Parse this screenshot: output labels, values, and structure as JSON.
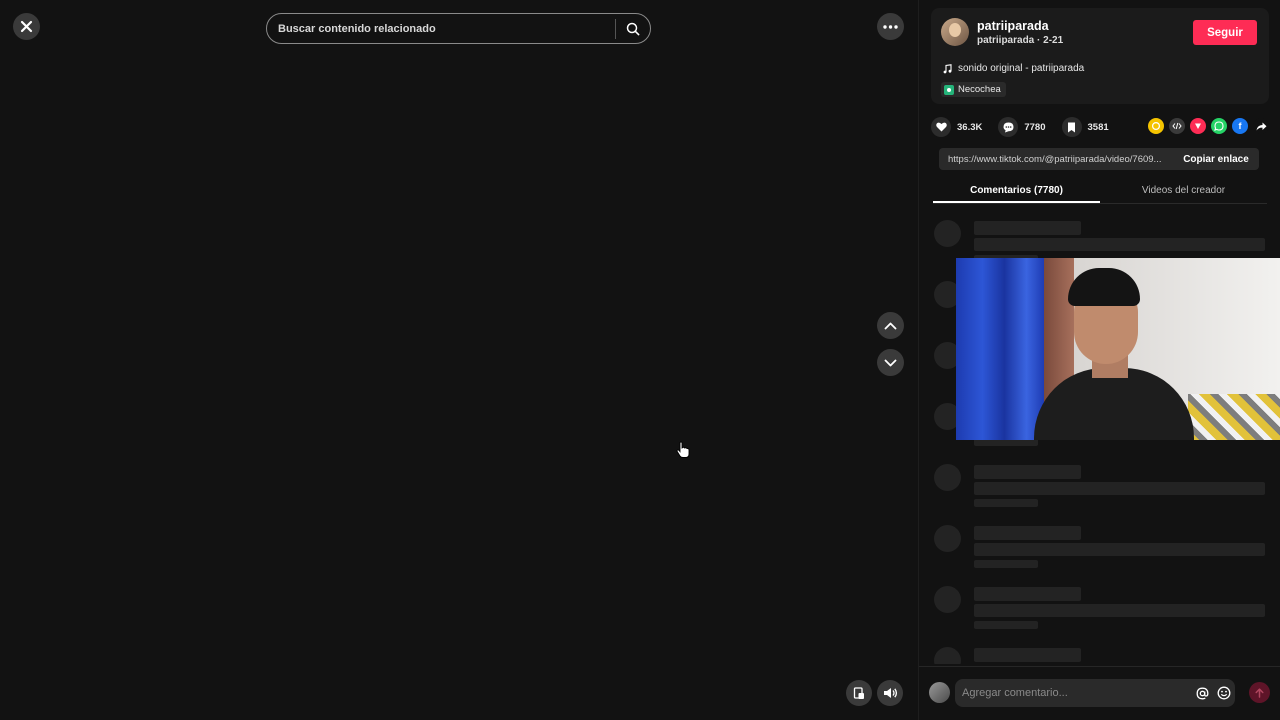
{
  "player": {
    "search_placeholder": "Buscar contenido relacionado"
  },
  "author": {
    "name": "patriiparada",
    "meta": "patriiparada · 2-21",
    "follow_label": "Seguir",
    "sound": "sonido original - patriiparada",
    "location": "Necochea"
  },
  "stats": {
    "likes": "36.3K",
    "comments": "7780",
    "saves": "3581"
  },
  "share": {
    "icons": [
      "coin-icon",
      "embed-icon",
      "send-icon",
      "whatsapp-icon",
      "facebook-icon",
      "share-arrow-icon"
    ],
    "colors": [
      "#f5c400",
      "#3a3a3a",
      "#fe2c55",
      "#25d366",
      "#1877f2",
      "#121212"
    ]
  },
  "link": {
    "url": "https://www.tiktok.com/@patriiparada/video/7609...",
    "copy_label": "Copiar enlace"
  },
  "tabs": [
    {
      "label": "Comentarios (7780)"
    },
    {
      "label": "Videos del creador"
    }
  ],
  "comment_bar": {
    "placeholder": "Agregar comentario..."
  },
  "colors": {
    "accent": "#fe2c55",
    "background": "#121212"
  }
}
